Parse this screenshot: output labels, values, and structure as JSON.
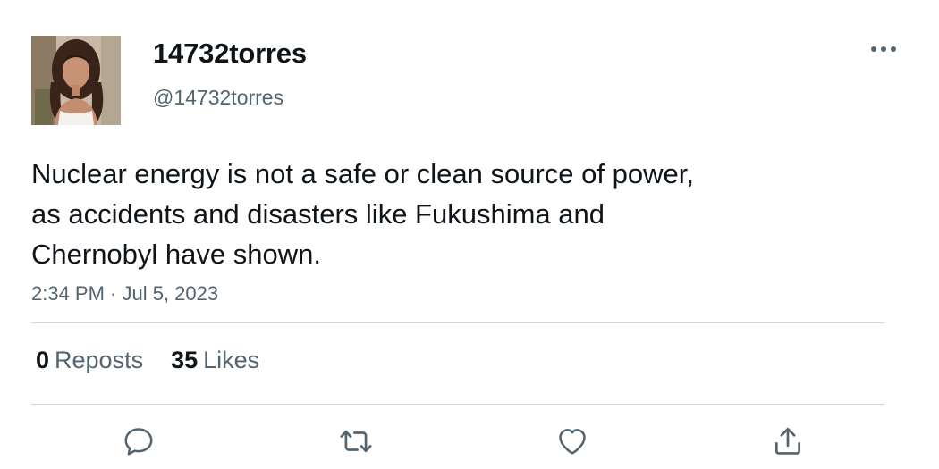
{
  "user": {
    "display_name": "14732torres",
    "handle": "@14732torres",
    "avatar": "profile-photo"
  },
  "tweet": {
    "text_lines": [
      "Nuclear energy is not a safe or clean source of power,",
      "as accidents and disasters like Fukushima and",
      "Chernobyl have shown."
    ],
    "timestamp": "2:34 PM · Jul 5, 2023"
  },
  "stats": {
    "reposts_count": "0",
    "reposts_label": "Reposts",
    "likes_count": "35",
    "likes_label": "Likes"
  },
  "actions": {
    "reply": "reply-icon",
    "repost": "repost-icon",
    "like": "heart-icon",
    "share": "share-icon",
    "more": "more-icon"
  },
  "colors": {
    "text_primary": "#0f1419",
    "text_secondary": "#536471",
    "divider": "#cfd9de"
  }
}
